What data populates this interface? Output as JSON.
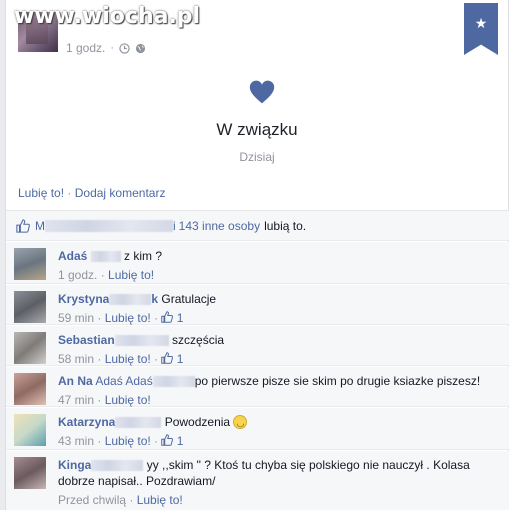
{
  "watermark": "www.wiocha.pl",
  "post": {
    "time": "1 godz.",
    "meta_sep": "·",
    "event_title": "W związku",
    "event_date": "Dzisiaj",
    "like_action": "Lubię to!",
    "comment_action": "Dodaj komentarz",
    "action_sep": "·"
  },
  "likes": {
    "name_start": "M",
    "name_end": "i",
    "others_link": "143 inne osoby",
    "suffix": "lubią to."
  },
  "comments": [
    {
      "name": "Adaś",
      "name_tail": "",
      "text": "z kim ?",
      "pre_text": "",
      "time": "1 godz.",
      "like": "Lubię to!",
      "count": "",
      "smiley": false
    },
    {
      "name": "Krystyna",
      "name_tail": "k",
      "text": "Gratulacje",
      "pre_text": "",
      "time": "59 min",
      "like": "Lubię to!",
      "count": "1",
      "smiley": false
    },
    {
      "name": "Sebastian",
      "name_tail": "",
      "text": "szczęścia",
      "pre_text": "",
      "time": "58 min",
      "like": "Lubię to!",
      "count": "1",
      "smiley": false
    },
    {
      "name": "An Na",
      "name_tail": "",
      "pre_text": "Adaś Adaś",
      "text": "po pierwsze pisze sie skim po drugie ksiazke piszesz!",
      "time": "47 min",
      "like": "Lubię to!",
      "count": "",
      "smiley": false
    },
    {
      "name": "Katarzyna",
      "name_tail": "",
      "text": "Powodzenia",
      "pre_text": "",
      "time": "43 min",
      "like": "Lubię to!",
      "count": "1",
      "smiley": true
    },
    {
      "name": "Kinga",
      "name_tail": "",
      "text": "yy ,,skim \" ? Ktoś tu chyba się polskiego nie nauczył . Kolasa dobrze napisał.. Pozdrawiam/",
      "pre_text": "",
      "time": "Przed chwilą",
      "like": "Lubię to!",
      "count": "",
      "smiley": false
    }
  ],
  "colors": {
    "link": "#4e69a2",
    "muted": "#90949c",
    "heart": "#4e69a2",
    "bookmark": "#4e69a2"
  },
  "icons": [
    "heart-icon",
    "globe-icon",
    "clock-icon",
    "thumb-up-icon",
    "star-icon",
    "smiley-icon"
  ]
}
